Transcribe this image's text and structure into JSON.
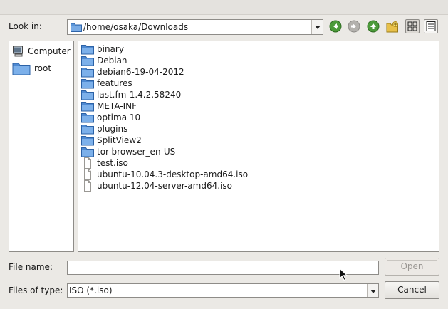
{
  "toolbar": {
    "look_in_label": "Look in:",
    "path": "/home/osaka/Downloads",
    "icons": [
      "back-icon",
      "forward-icon",
      "parent-directory-icon",
      "new-folder-icon",
      "list-view-icon",
      "detail-view-icon"
    ]
  },
  "sidebar": {
    "items": [
      {
        "label": "Computer",
        "icon": "computer-icon"
      },
      {
        "label": "root",
        "icon": "folder-icon"
      }
    ]
  },
  "files": [
    {
      "name": "binary",
      "kind": "folder"
    },
    {
      "name": "Debian",
      "kind": "folder"
    },
    {
      "name": "debian6-19-04-2012",
      "kind": "folder"
    },
    {
      "name": "features",
      "kind": "folder"
    },
    {
      "name": "last.fm-1.4.2.58240",
      "kind": "folder"
    },
    {
      "name": "META-INF",
      "kind": "folder"
    },
    {
      "name": "optima 10",
      "kind": "folder"
    },
    {
      "name": "plugins",
      "kind": "folder"
    },
    {
      "name": "SplitView2",
      "kind": "folder"
    },
    {
      "name": "tor-browser_en-US",
      "kind": "folder"
    },
    {
      "name": "test.iso",
      "kind": "file"
    },
    {
      "name": "ubuntu-10.04.3-desktop-amd64.iso",
      "kind": "file"
    },
    {
      "name": "ubuntu-12.04-server-amd64.iso",
      "kind": "file"
    }
  ],
  "footer": {
    "file_name_label_pre": "File ",
    "file_name_label_mnemonic": "n",
    "file_name_label_post": "ame:",
    "file_name_value": "",
    "files_of_type_label": "Files of type:",
    "files_of_type_value": "ISO (*.iso)",
    "open_label": "Open",
    "cancel_label": "Cancel"
  },
  "colors": {
    "folder": "#3d7fcf",
    "nav_green": "#4c9a3a",
    "nav_disabled": "#a9a7a3"
  }
}
